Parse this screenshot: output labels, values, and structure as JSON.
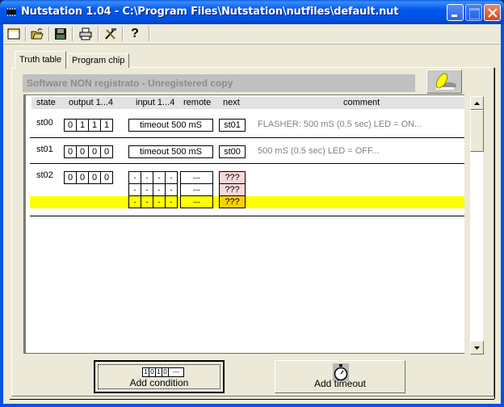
{
  "window": {
    "title": "Nutstation 1.04 - C:\\Program Files\\Nutstation\\nutfiles\\default.nut"
  },
  "toolbar": {
    "items": [
      {
        "icon": "new-file-icon",
        "label": "New"
      },
      {
        "icon": "open-folder-icon",
        "label": "Open"
      },
      {
        "icon": "save-disk-icon",
        "label": "Save"
      },
      {
        "icon": "printer-icon",
        "label": "Print"
      },
      {
        "icon": "tools-icon",
        "label": "Tools"
      },
      {
        "icon": "help-icon",
        "label": "?"
      }
    ]
  },
  "tabs": [
    {
      "label": "Truth table",
      "active": true
    },
    {
      "label": "Program chip",
      "active": false
    }
  ],
  "registration": {
    "text": "Software NON registrato - Unregistered copy"
  },
  "grid": {
    "headers": {
      "state": "state",
      "output": "output 1...4",
      "input": "input 1...4",
      "remote": "remote",
      "next": "next",
      "comment": "comment"
    },
    "rows": [
      {
        "state": "st00",
        "outputs": [
          "0",
          "1",
          "1",
          "1"
        ],
        "condition": "timeout 500 mS",
        "next": "st01",
        "comment": "FLASHER: 500 mS (0.5 sec) LED = ON..."
      },
      {
        "state": "st01",
        "outputs": [
          "0",
          "0",
          "0",
          "0"
        ],
        "condition": "timeout 500 mS",
        "next": "st00",
        "comment": "500 mS (0.5 sec) LED = OFF..."
      },
      {
        "state": "st02",
        "outputs": [
          "0",
          "0",
          "0",
          "0"
        ],
        "conditions": [
          {
            "inputs": [
              "-",
              "-",
              "-",
              "-"
            ],
            "remote": "---",
            "next": "???"
          },
          {
            "inputs": [
              "-",
              "-",
              "-",
              "-"
            ],
            "remote": "---",
            "next": "???"
          },
          {
            "inputs": [
              "-",
              "-",
              "-",
              "-"
            ],
            "remote": "---",
            "next": "???",
            "selected": true
          }
        ],
        "comment": ""
      }
    ]
  },
  "buttons": {
    "add_condition": "Add condition",
    "add_condition_icon_bits": [
      "1",
      "0",
      "1",
      "0",
      "---"
    ],
    "add_timeout": "Add timeout"
  },
  "colors": {
    "selected_row": "#ffff00",
    "pending_next": "#f8d8d8",
    "selected_next": "#ffd000",
    "titlebar": "#0054e3"
  }
}
